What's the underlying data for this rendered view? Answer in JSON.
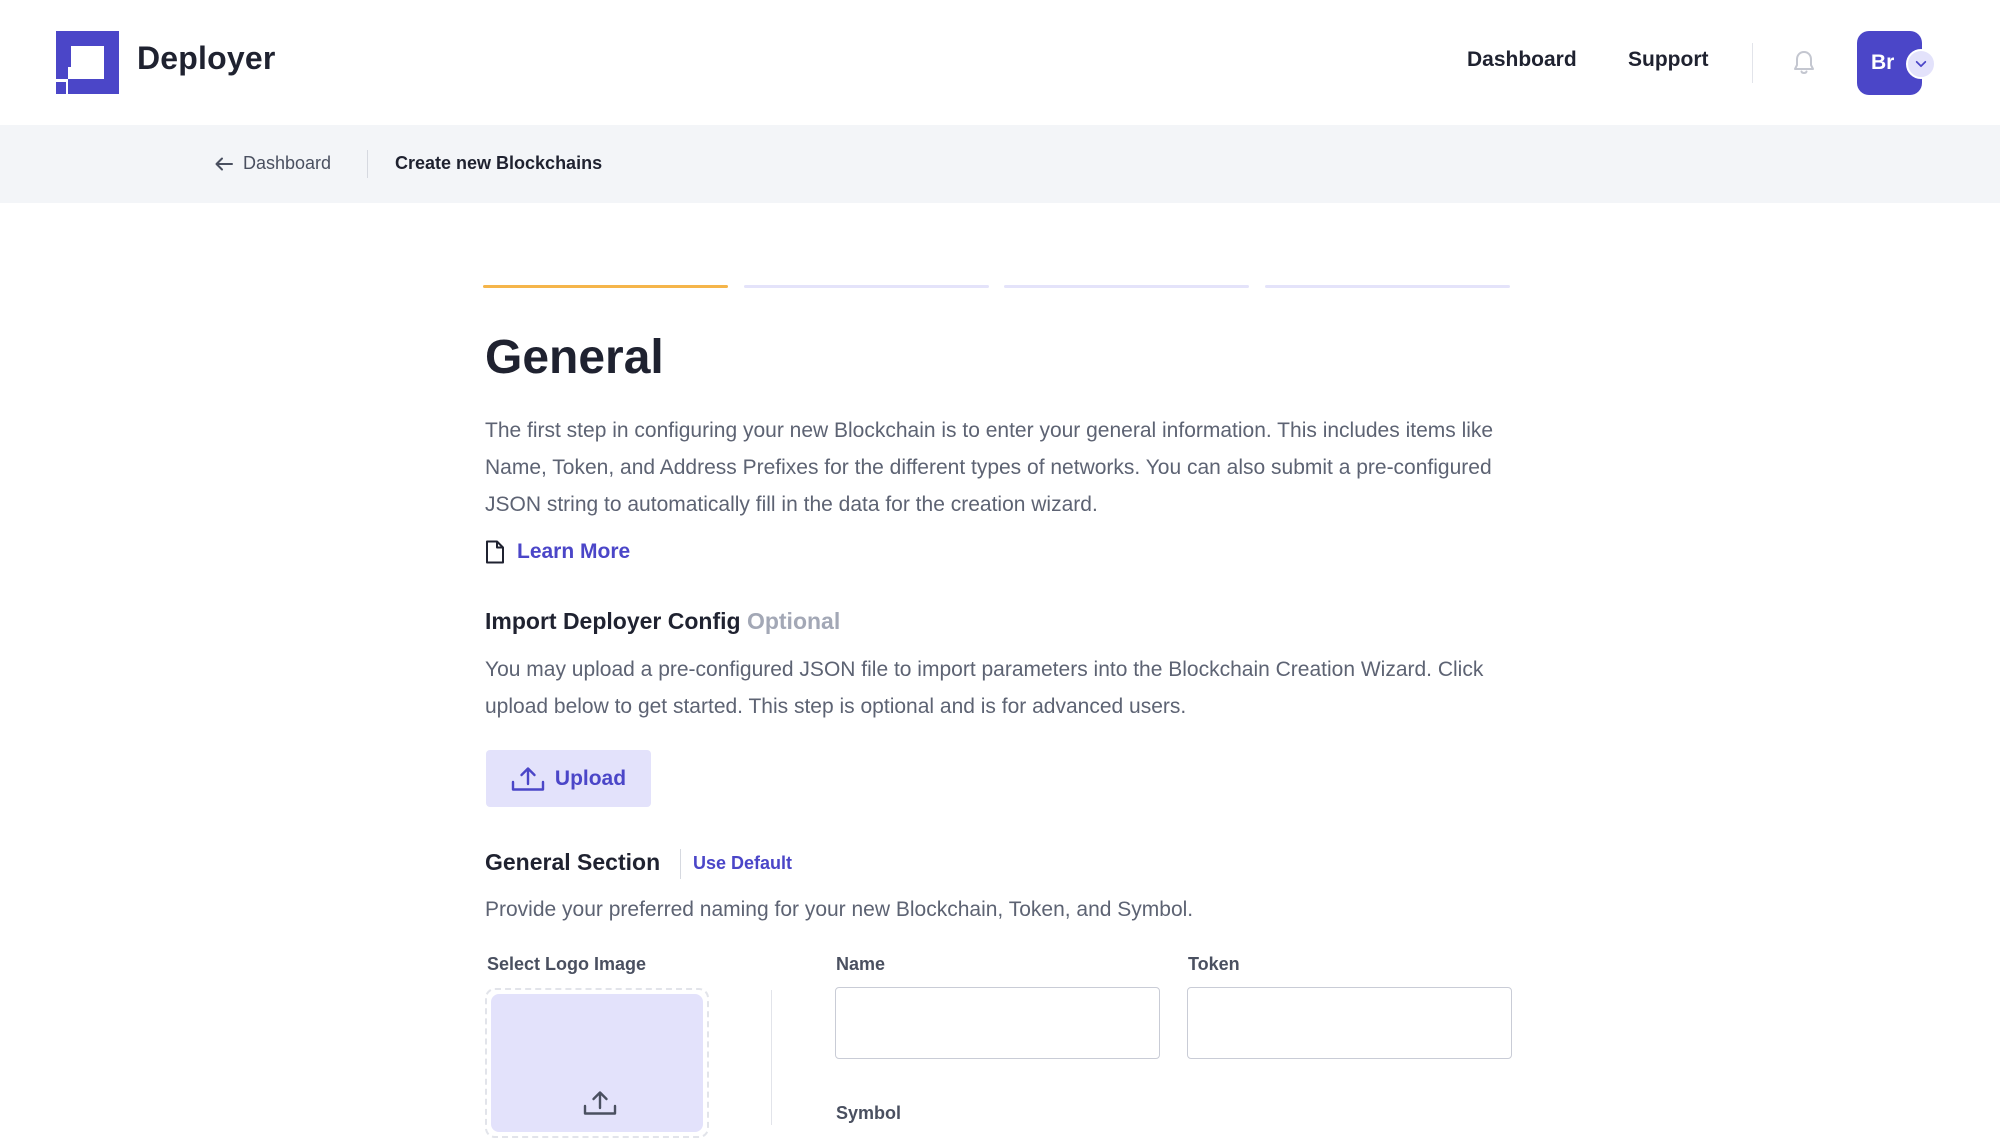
{
  "header": {
    "brand": "Deployer",
    "nav": {
      "dashboard": "Dashboard",
      "support": "Support"
    },
    "avatar_initials": "Br",
    "icons": [
      "bell-icon",
      "chevron-down-icon"
    ]
  },
  "breadcrumb": {
    "back_label": "Dashboard",
    "current": "Create new Blockchains"
  },
  "stepper": {
    "total_steps": 4,
    "active_step": 1,
    "active_color": "#f5b54a",
    "inactive_color": "#e4e3fa"
  },
  "main": {
    "title": "General",
    "intro": "The first step in configuring your new Blockchain is to enter your general information. This includes items like Name, Token, and Address Prefixes for the different types of networks. You can also submit a pre-configured JSON string to automatically fill in the data for the creation wizard.",
    "learn_more": "Learn More"
  },
  "import_section": {
    "title": "Import Deployer Config",
    "optional": "Optional",
    "description": "You may upload a pre-configured JSON file to import parameters into the Blockchain Creation Wizard. Click upload below to get started. This step is optional and is for advanced users.",
    "upload_label": "Upload"
  },
  "general_section": {
    "title": "General Section",
    "use_default": "Use Default",
    "description": "Provide your preferred naming for your new Blockchain, Token, and Symbol.",
    "fields": {
      "logo_label": "Select Logo Image",
      "name_label": "Name",
      "name_value": "",
      "token_label": "Token",
      "token_value": "",
      "symbol_label": "Symbol"
    }
  },
  "colors": {
    "accent": "#4b46c8",
    "accent_light": "#e3e2fb",
    "breadcrumb_bg": "#f3f5f8"
  }
}
